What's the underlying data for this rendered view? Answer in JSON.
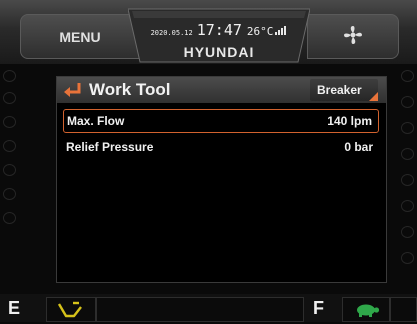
{
  "header": {
    "menu_label": "MENU",
    "date": "2020.05.12",
    "time": "17:47",
    "temperature": "26°C",
    "brand": "HYUNDAI",
    "fan_icon": "fan-icon",
    "signal_icon": "signal-strength-icon"
  },
  "panel": {
    "title": "Work Tool",
    "back_icon": "return-arrow-icon",
    "mode": "Breaker",
    "rows": [
      {
        "label": "Max. Flow",
        "value": "140 lpm",
        "selected": true
      },
      {
        "label": "Relief Pressure",
        "value": "0 bar",
        "selected": false
      }
    ]
  },
  "footer": {
    "left_gear": "E",
    "right_gear": "F",
    "left_icon": "work-mode-icon",
    "right_icon": "turtle-icon"
  },
  "colors": {
    "accent": "#e8733a",
    "selection_border": "#d2622e",
    "icon_yellow": "#d6c21a",
    "icon_green": "#2fa84a"
  }
}
